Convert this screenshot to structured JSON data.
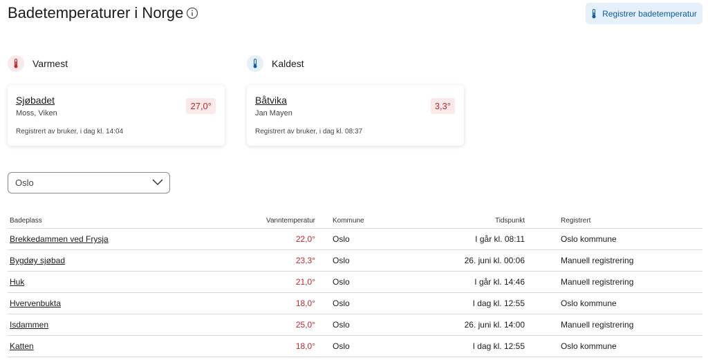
{
  "header": {
    "title": "Badetemperaturer i Norge",
    "register_label": "Registrer badetemperatur"
  },
  "warmest": {
    "heading": "Varmest",
    "name": "Sjøbadet",
    "location": "Moss, Viken",
    "registered": "Registrert av bruker, i dag kl. 14:04",
    "temp": "27,0°"
  },
  "coldest": {
    "heading": "Kaldest",
    "name": "Båtvika",
    "location": "Jan Mayen",
    "registered": "Registrert av bruker, i dag kl. 08:37",
    "temp": "3,3°"
  },
  "filter": {
    "selected": "Oslo"
  },
  "table": {
    "columns": {
      "name": "Badeplass",
      "temp": "Vanntemperatur",
      "kommune": "Kommune",
      "time": "Tidspunkt",
      "registered": "Registrert"
    },
    "rows": [
      {
        "name": "Brekkedammen ved Frysja",
        "temp": "22,0°",
        "kommune": "Oslo",
        "time": "I går kl. 08:11",
        "registered": "Oslo kommune"
      },
      {
        "name": "Bygdøy sjøbad",
        "temp": "23,3°",
        "kommune": "Oslo",
        "time": "26. juni kl. 00:06",
        "registered": "Manuell registrering"
      },
      {
        "name": "Huk",
        "temp": "21,0°",
        "kommune": "Oslo",
        "time": "I går kl. 14:46",
        "registered": "Manuell registrering"
      },
      {
        "name": "Hvervenbukta",
        "temp": "18,0°",
        "kommune": "Oslo",
        "time": "I dag kl. 12:55",
        "registered": "Oslo kommune"
      },
      {
        "name": "Isdammen",
        "temp": "25,0°",
        "kommune": "Oslo",
        "time": "26. juni kl. 14:00",
        "registered": "Manuell registrering"
      },
      {
        "name": "Katten",
        "temp": "18,0°",
        "kommune": "Oslo",
        "time": "I dag kl. 12:55",
        "registered": "Oslo kommune"
      }
    ]
  },
  "colors": {
    "accent_blue": "#0b5cad",
    "warm_red": "#c0272d",
    "warm_bg": "#fbe9e9",
    "cold_bg": "#e6f0fa"
  },
  "icons": {
    "info": "info-icon",
    "warm": "thermometer-hot-icon",
    "cold": "thermometer-cold-icon",
    "dropdown": "chevron-down-icon"
  }
}
